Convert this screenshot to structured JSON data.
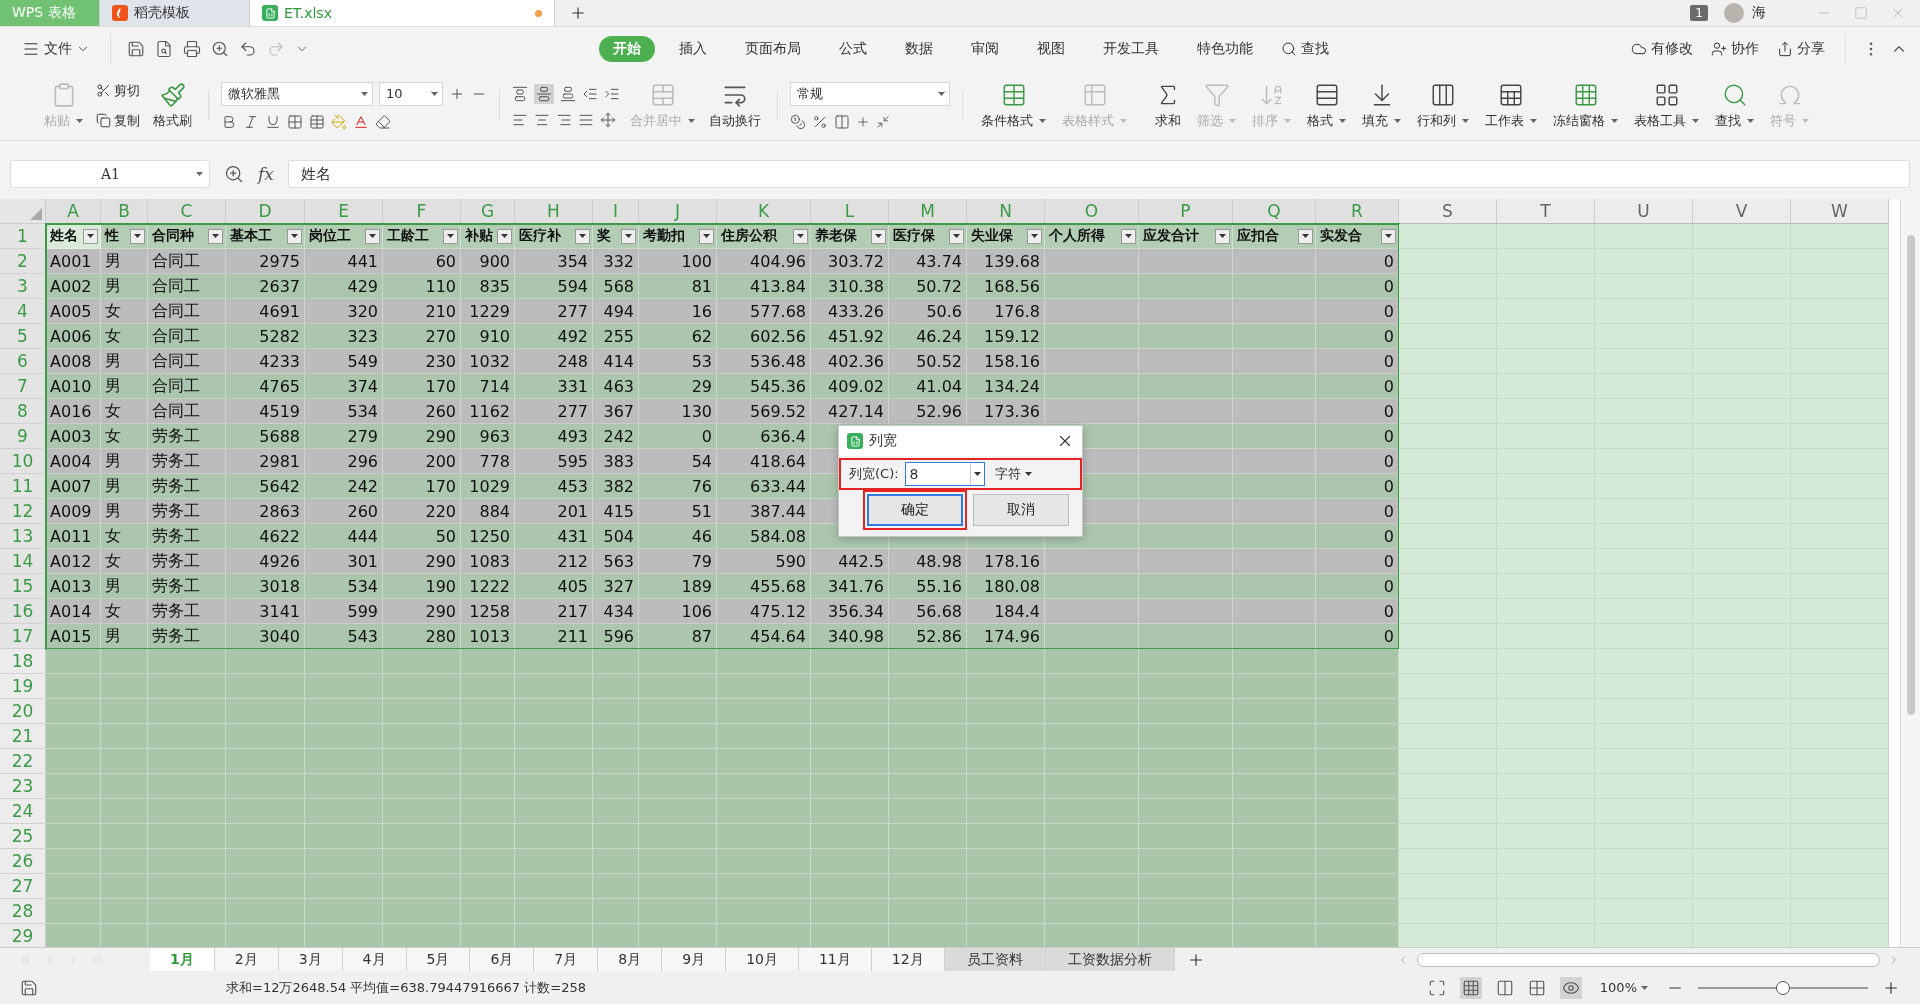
{
  "title_tabs": [
    {
      "label": "WPS 表格",
      "kind": "app",
      "selected": false
    },
    {
      "label": "稻壳模板",
      "kind": "template",
      "selected": false
    },
    {
      "label": "ET.xlsx",
      "kind": "file",
      "selected": true,
      "unsaved": true
    }
  ],
  "title_right": {
    "badge": "1",
    "user": "海"
  },
  "file_menu": "文件",
  "menu_tabs": [
    {
      "label": "开始",
      "selected": true
    },
    {
      "label": "插入",
      "selected": false
    },
    {
      "label": "页面布局",
      "selected": false
    },
    {
      "label": "公式",
      "selected": false
    },
    {
      "label": "数据",
      "selected": false
    },
    {
      "label": "审阅",
      "selected": false
    },
    {
      "label": "视图",
      "selected": false
    },
    {
      "label": "开发工具",
      "selected": false
    },
    {
      "label": "特色功能",
      "selected": false
    }
  ],
  "search_label": "查找",
  "menu_right": [
    "有修改",
    "协作",
    "分享"
  ],
  "ribbon": {
    "clipboard": [
      {
        "label": "粘贴",
        "disabled": true
      },
      {
        "label": "剪切",
        "disabled": false
      },
      {
        "label": "复制",
        "disabled": false
      },
      {
        "label": "格式刷",
        "disabled": false
      }
    ],
    "font_name": "微软雅黑",
    "font_size": "10",
    "number_format": "常规",
    "mid_buttons": [
      {
        "label": "合并居中",
        "disabled": true
      },
      {
        "label": "自动换行",
        "disabled": false
      }
    ],
    "right_buttons": [
      {
        "label": "条件格式",
        "disabled": false
      },
      {
        "label": "表格样式",
        "disabled": true
      },
      {
        "label": "求和",
        "disabled": false
      },
      {
        "label": "筛选",
        "disabled": true
      },
      {
        "label": "排序",
        "disabled": true
      },
      {
        "label": "格式",
        "disabled": false
      },
      {
        "label": "填充",
        "disabled": false
      },
      {
        "label": "行和列",
        "disabled": false
      },
      {
        "label": "工作表",
        "disabled": false
      },
      {
        "label": "冻结窗格",
        "disabled": false
      },
      {
        "label": "表格工具",
        "disabled": false
      },
      {
        "label": "查找",
        "disabled": false
      },
      {
        "label": "符号",
        "disabled": true
      }
    ]
  },
  "formula_bar": {
    "cell_ref": "A1",
    "fx_label": "fx",
    "value": "姓名"
  },
  "sheet": {
    "column_letters": [
      "A",
      "B",
      "C",
      "D",
      "E",
      "F",
      "G",
      "H",
      "I",
      "J",
      "K",
      "L",
      "M",
      "N",
      "O",
      "P",
      "Q",
      "R"
    ],
    "extra_column_letters": [
      "S",
      "T",
      "U",
      "V",
      "W"
    ],
    "header_row": {
      "number": "1",
      "cells": [
        "姓名",
        "性",
        "合同种",
        "基本工",
        "岗位工",
        "工龄工",
        "补贴",
        "医疗补",
        "奖",
        "考勤扣",
        "住房公积",
        "养老保",
        "医疗保",
        "失业保",
        "个人所得",
        "应发合计",
        "应扣合",
        "实发合"
      ]
    },
    "rows": [
      {
        "number": "2",
        "cells": [
          "A001",
          "男",
          "合同工",
          "2975",
          "441",
          "60",
          "900",
          "354",
          "332",
          "100",
          "404.96",
          "303.72",
          "43.74",
          "139.68",
          null,
          null,
          null,
          "0"
        ]
      },
      {
        "number": "3",
        "cells": [
          "A002",
          "男",
          "合同工",
          "2637",
          "429",
          "110",
          "835",
          "594",
          "568",
          "81",
          "413.84",
          "310.38",
          "50.72",
          "168.56",
          null,
          null,
          null,
          "0"
        ]
      },
      {
        "number": "4",
        "cells": [
          "A005",
          "女",
          "合同工",
          "4691",
          "320",
          "210",
          "1229",
          "277",
          "494",
          "16",
          "577.68",
          "433.26",
          "50.6",
          "176.8",
          null,
          null,
          null,
          "0"
        ]
      },
      {
        "number": "5",
        "cells": [
          "A006",
          "女",
          "合同工",
          "5282",
          "323",
          "270",
          "910",
          "492",
          "255",
          "62",
          "602.56",
          "451.92",
          "46.24",
          "159.12",
          null,
          null,
          null,
          "0"
        ]
      },
      {
        "number": "6",
        "cells": [
          "A008",
          "男",
          "合同工",
          "4233",
          "549",
          "230",
          "1032",
          "248",
          "414",
          "53",
          "536.48",
          "402.36",
          "50.52",
          "158.16",
          null,
          null,
          null,
          "0"
        ]
      },
      {
        "number": "7",
        "cells": [
          "A010",
          "男",
          "合同工",
          "4765",
          "374",
          "170",
          "714",
          "331",
          "463",
          "29",
          "545.36",
          "409.02",
          "41.04",
          "134.24",
          null,
          null,
          null,
          "0"
        ]
      },
      {
        "number": "8",
        "cells": [
          "A016",
          "女",
          "合同工",
          "4519",
          "534",
          "260",
          "1162",
          "277",
          "367",
          "130",
          "569.52",
          "427.14",
          "52.96",
          "173.36",
          null,
          null,
          null,
          "0"
        ]
      },
      {
        "number": "9",
        "cells": [
          "A003",
          "女",
          "劳务工",
          "5688",
          "279",
          "290",
          "963",
          "493",
          "242",
          "0",
          "636.4",
          null,
          null,
          null,
          null,
          null,
          null,
          "0"
        ]
      },
      {
        "number": "10",
        "cells": [
          "A004",
          "男",
          "劳务工",
          "2981",
          "296",
          "200",
          "778",
          "595",
          "383",
          "54",
          "418.64",
          null,
          null,
          null,
          null,
          null,
          null,
          "0"
        ]
      },
      {
        "number": "11",
        "cells": [
          "A007",
          "男",
          "劳务工",
          "5642",
          "242",
          "170",
          "1029",
          "453",
          "382",
          "76",
          "633.44",
          null,
          null,
          null,
          null,
          null,
          null,
          "0"
        ]
      },
      {
        "number": "12",
        "cells": [
          "A009",
          "男",
          "劳务工",
          "2863",
          "260",
          "220",
          "884",
          "201",
          "415",
          "51",
          "387.44",
          null,
          null,
          null,
          null,
          null,
          null,
          "0"
        ]
      },
      {
        "number": "13",
        "cells": [
          "A011",
          "女",
          "劳务工",
          "4622",
          "444",
          "50",
          "1250",
          "431",
          "504",
          "46",
          "584.08",
          null,
          null,
          null,
          null,
          null,
          null,
          "0"
        ]
      },
      {
        "number": "14",
        "cells": [
          "A012",
          "女",
          "劳务工",
          "4926",
          "301",
          "290",
          "1083",
          "212",
          "563",
          "79",
          "590",
          "442.5",
          "48.98",
          "178.16",
          null,
          null,
          null,
          "0"
        ]
      },
      {
        "number": "15",
        "cells": [
          "A013",
          "男",
          "劳务工",
          "3018",
          "534",
          "190",
          "1222",
          "405",
          "327",
          "189",
          "455.68",
          "341.76",
          "55.16",
          "180.08",
          null,
          null,
          null,
          "0"
        ]
      },
      {
        "number": "16",
        "cells": [
          "A014",
          "女",
          "劳务工",
          "3141",
          "599",
          "290",
          "1258",
          "217",
          "434",
          "106",
          "475.12",
          "356.34",
          "56.68",
          "184.4",
          null,
          null,
          null,
          "0"
        ]
      },
      {
        "number": "17",
        "cells": [
          "A015",
          "男",
          "劳务工",
          "3040",
          "543",
          "280",
          "1013",
          "211",
          "596",
          "87",
          "454.64",
          "340.98",
          "52.86",
          "174.96",
          null,
          null,
          null,
          "0"
        ]
      }
    ],
    "empty_row_numbers": [
      "18",
      "19",
      "20",
      "21",
      "22",
      "23",
      "24",
      "25",
      "26",
      "27",
      "28",
      "29"
    ]
  },
  "dialog": {
    "title": "列宽",
    "field_label": "列宽(C):",
    "value": "8",
    "unit": "字符",
    "ok": "确定",
    "cancel": "取消"
  },
  "sheet_tabs": [
    {
      "label": "1月",
      "selected": true,
      "kind": "month"
    },
    {
      "label": "2月",
      "selected": false,
      "kind": "month"
    },
    {
      "label": "3月",
      "selected": false,
      "kind": "month"
    },
    {
      "label": "4月",
      "selected": false,
      "kind": "month"
    },
    {
      "label": "5月",
      "selected": false,
      "kind": "month"
    },
    {
      "label": "6月",
      "selected": false,
      "kind": "month"
    },
    {
      "label": "7月",
      "selected": false,
      "kind": "month"
    },
    {
      "label": "8月",
      "selected": false,
      "kind": "month"
    },
    {
      "label": "9月",
      "selected": false,
      "kind": "month"
    },
    {
      "label": "10月",
      "selected": false,
      "kind": "month"
    },
    {
      "label": "11月",
      "selected": false,
      "kind": "month"
    },
    {
      "label": "12月",
      "selected": false,
      "kind": "month"
    },
    {
      "label": "员工资料",
      "selected": false,
      "kind": "other"
    },
    {
      "label": "工资数据分析",
      "selected": false,
      "kind": "other"
    }
  ],
  "status_bar": {
    "summary": "求和=12万2648.54 平均值=638.79447916667 计数=258",
    "zoom": "100%",
    "zoom_slider": {
      "level": 0.5
    }
  }
}
